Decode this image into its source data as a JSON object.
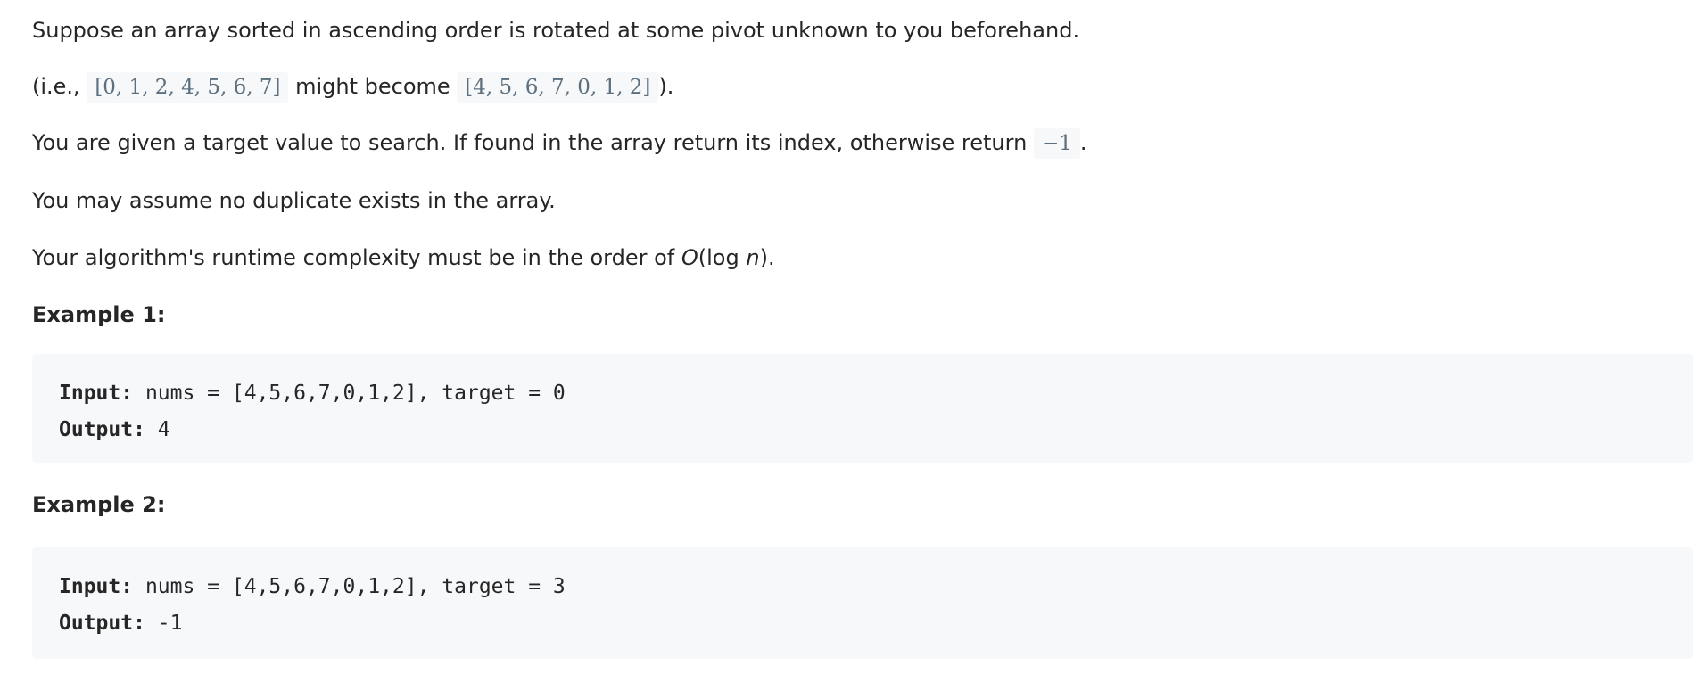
{
  "intro": {
    "line1": "Suppose an array sorted in ascending order is rotated at some pivot unknown to you beforehand.",
    "line2_prefix": "(i.e.,",
    "line2_array1": "[0, 1, 2, 4, 5, 6, 7]",
    "line2_middle": "might become",
    "line2_array2": "[4, 5, 6, 7, 0, 1, 2]",
    "line2_suffix": ").",
    "line3_text": "You are given a target value to search. If found in the array return its index, otherwise return",
    "line3_code": "−1",
    "line3_suffix": ".",
    "line4": "You may assume no duplicate exists in the array.",
    "line5_prefix": "Your algorithm's runtime complexity must be in the order of",
    "line5_O": "O",
    "line5_log": "(log",
    "line5_n": "n",
    "line5_suffix": ")."
  },
  "examples": [
    {
      "title": "Example 1:",
      "input_label": "Input:",
      "input_value": " nums = [4,5,6,7,0,1,2], target = 0",
      "output_label": "Output:",
      "output_value": " 4"
    },
    {
      "title": "Example 2:",
      "input_label": "Input:",
      "input_value": " nums = [4,5,6,7,0,1,2], target = 3",
      "output_label": "Output:",
      "output_value": " -1"
    }
  ]
}
